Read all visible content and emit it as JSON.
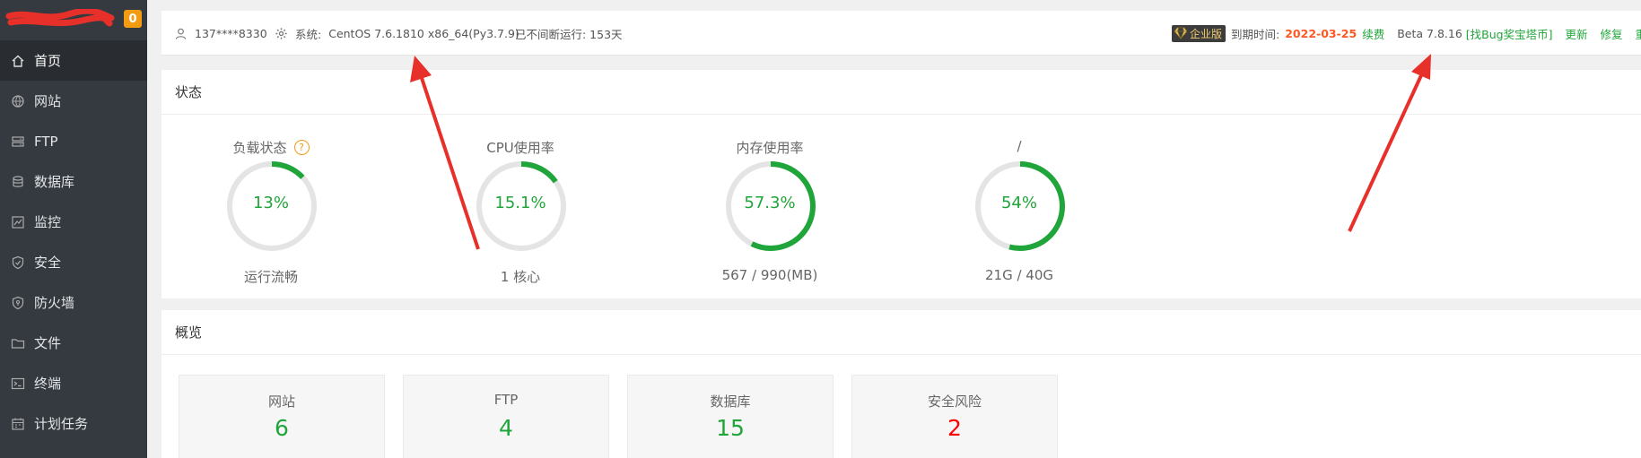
{
  "sidebar": {
    "badge": "0",
    "items": [
      {
        "label": "首页",
        "icon": "home-icon",
        "active": true
      },
      {
        "label": "网站",
        "icon": "globe-icon"
      },
      {
        "label": "FTP",
        "icon": "ftp-icon"
      },
      {
        "label": "数据库",
        "icon": "database-icon"
      },
      {
        "label": "监控",
        "icon": "monitor-icon"
      },
      {
        "label": "安全",
        "icon": "shield-icon"
      },
      {
        "label": "防火墙",
        "icon": "firewall-icon"
      },
      {
        "label": "文件",
        "icon": "folder-icon"
      },
      {
        "label": "终端",
        "icon": "terminal-icon"
      },
      {
        "label": "计划任务",
        "icon": "calendar-icon"
      }
    ]
  },
  "topbar": {
    "user": "137****8330",
    "system_label": "系统:",
    "system_value": "CentOS 7.6.1810 x86_64(Py3.7.9)",
    "uptime": "已不间断运行: 153天",
    "edition": "企业版",
    "expire_label": "到期时间:",
    "expire_date": "2022-03-25",
    "renew": "续费",
    "version": "Beta  7.8.16",
    "bug_bounty": "[找Bug奖宝塔币]",
    "update": "更新",
    "repair": "修复",
    "restart": "重启"
  },
  "status": {
    "title": "状态",
    "gauges": [
      {
        "title": "负载状态",
        "value": "13%",
        "percent": 13,
        "sub": "运行流畅",
        "help": "?"
      },
      {
        "title": "CPU使用率",
        "value": "15.1%",
        "percent": 15.1,
        "sub": "1 核心"
      },
      {
        "title": "内存使用率",
        "value": "57.3%",
        "percent": 57.3,
        "sub": "567 / 990(MB)"
      },
      {
        "title": "/",
        "value": "54%",
        "percent": 54,
        "sub": "21G / 40G"
      }
    ]
  },
  "overview": {
    "title": "概览",
    "cards": [
      {
        "label": "网站",
        "value": "6"
      },
      {
        "label": "FTP",
        "value": "4"
      },
      {
        "label": "数据库",
        "value": "15"
      },
      {
        "label": "安全风险",
        "value": "2",
        "danger": true
      }
    ]
  },
  "colors": {
    "sidebar_bg": "#353a40",
    "accent_green": "#20a53a",
    "track_gray": "#e4e4e4",
    "badge_orange": "#f39b12",
    "danger_red": "#ff0000",
    "arrow_red": "#e8302b"
  }
}
